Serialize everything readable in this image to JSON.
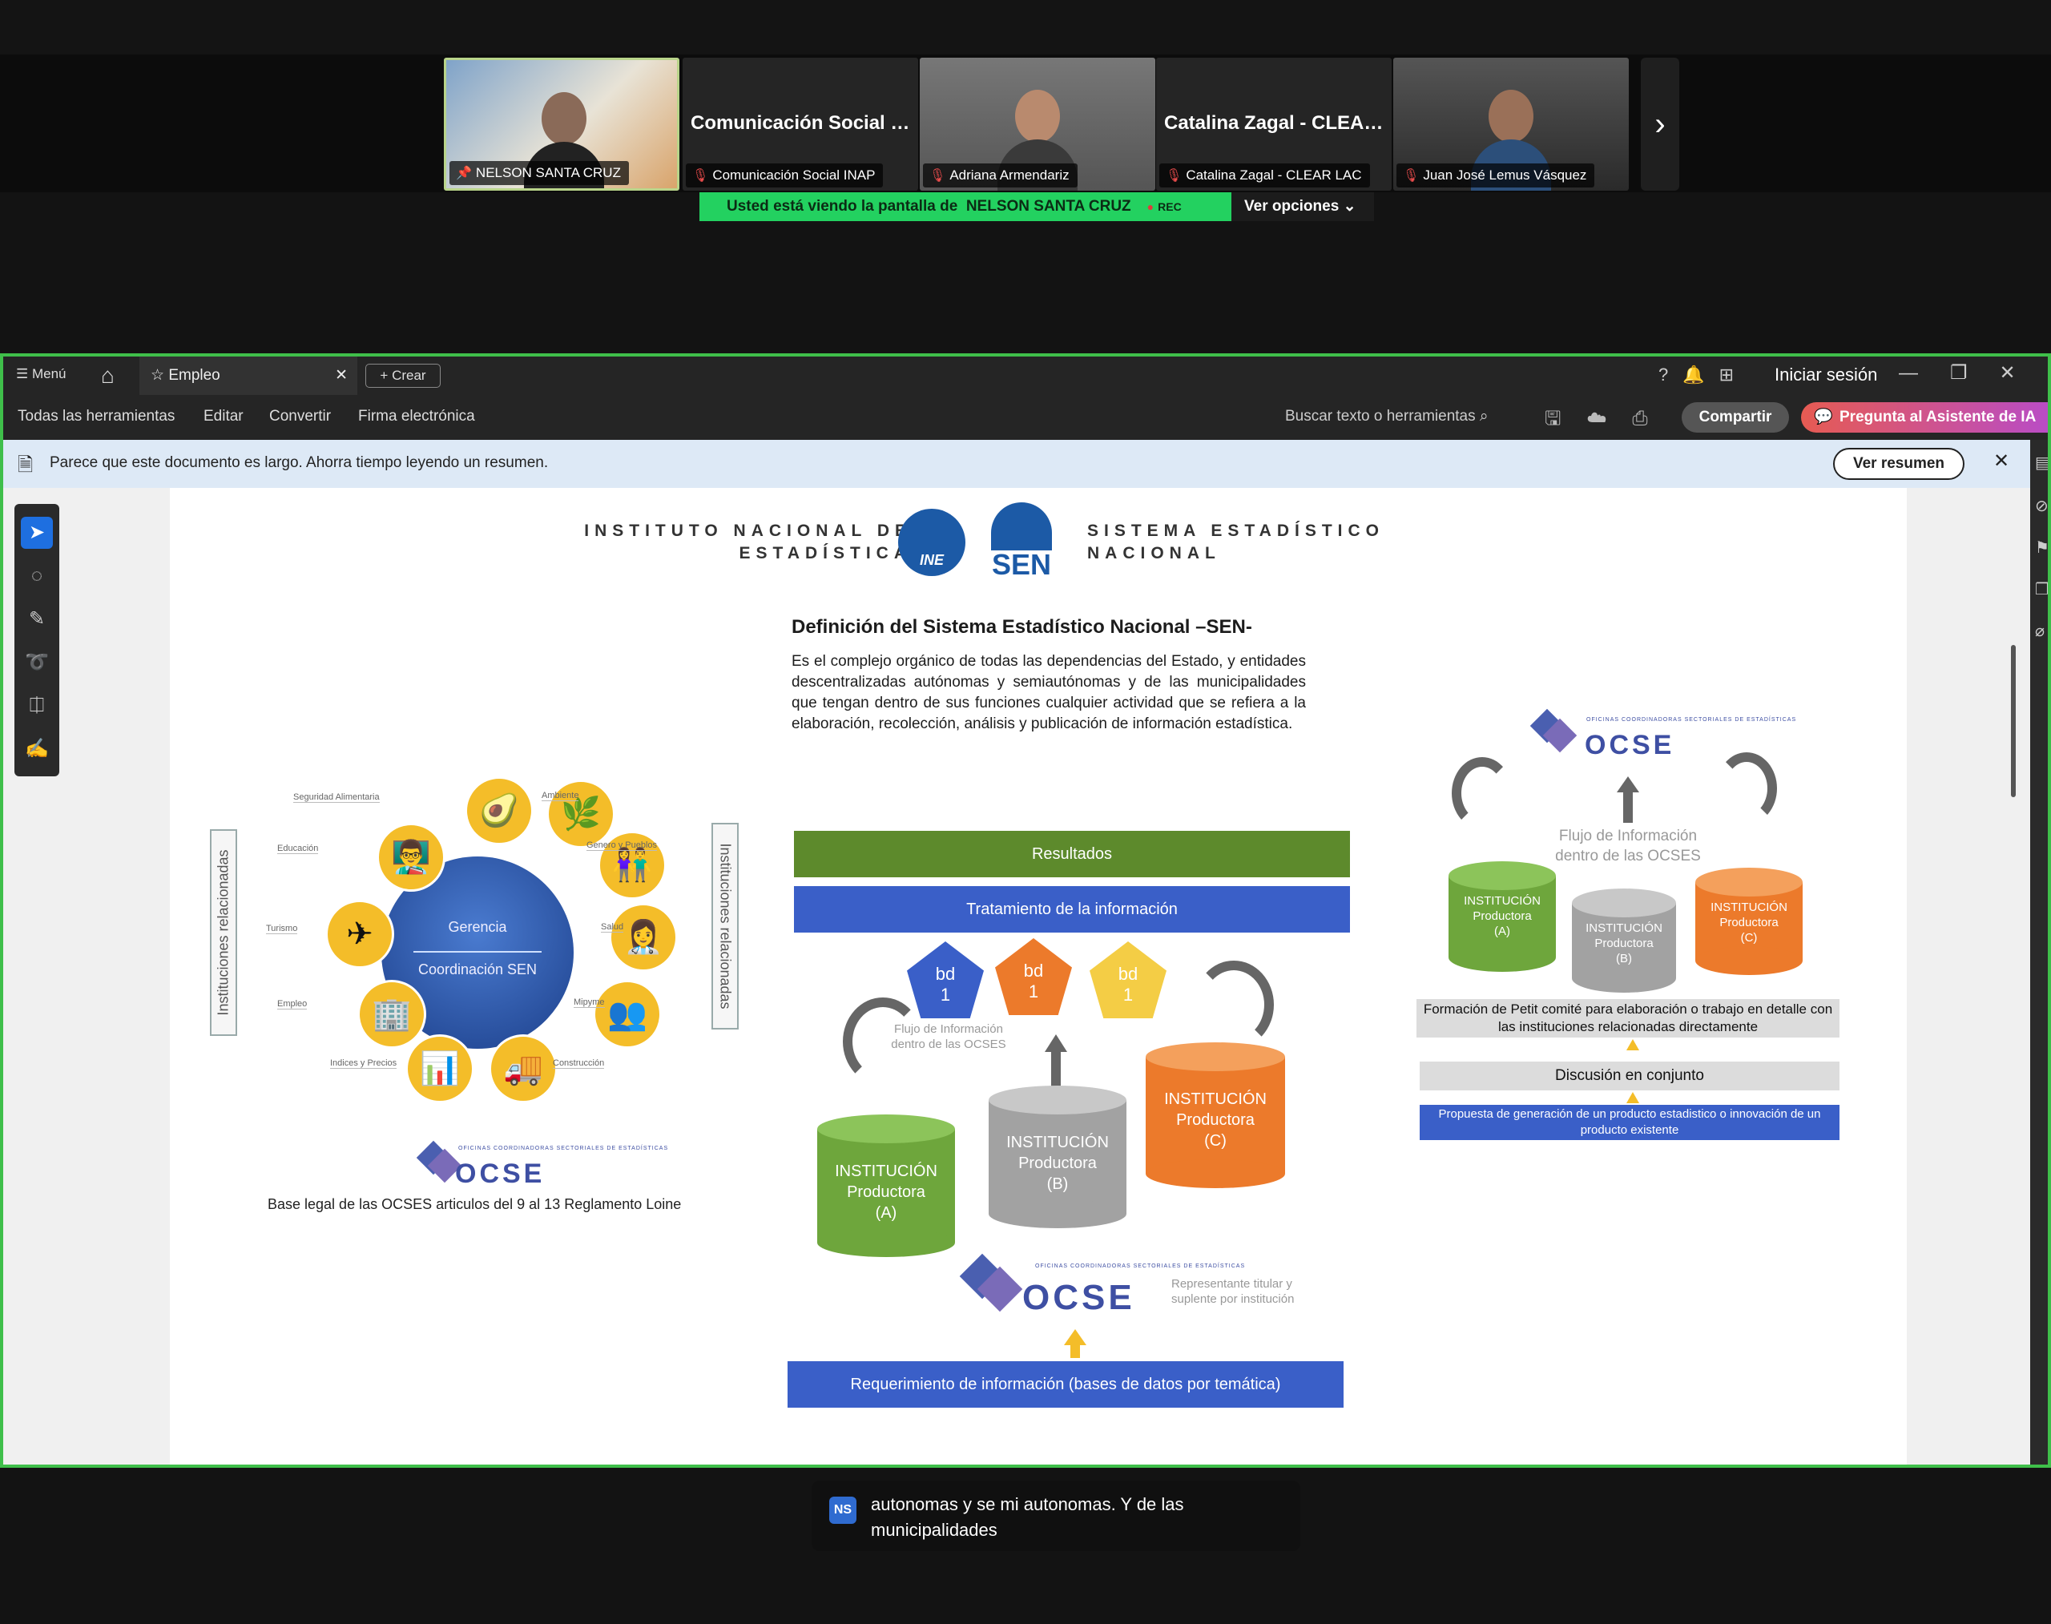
{
  "meeting": {
    "participants": [
      {
        "name": "NELSON SANTA CRUZ",
        "display": "",
        "pinned": true
      },
      {
        "name": "Comunicación Social INAP",
        "display": "Comunicación Social IN...",
        "pinned": false
      },
      {
        "name": "Adriana Armendariz",
        "display": "",
        "pinned": false
      },
      {
        "name": "Catalina Zagal - CLEAR LAC",
        "display": "Catalina Zagal - CLEAR...",
        "pinned": false
      },
      {
        "name": "Juan José Lemus Vásquez",
        "display": "",
        "pinned": false
      }
    ],
    "viewing_prefix": "Usted está viendo la pantalla de",
    "viewing_name": "NELSON SANTA CRUZ",
    "rec_label": "REC",
    "options_label": "Ver opciones",
    "caption_initials": "NS",
    "caption_text": "autonomas y se mi autonomas. Y de las municipalidades",
    "colors": {
      "viewing_green": "#23d160",
      "share_border": "#3fbf4a"
    }
  },
  "viewer": {
    "menu_label": "Menú",
    "tab_label": "Empleo",
    "create_label": "Crear",
    "signin_label": "Iniciar sesión",
    "toolbar": [
      "Todas las herramientas",
      "Editar",
      "Convertir",
      "Firma electrónica"
    ],
    "search_label": "Buscar texto o herramientas",
    "share_label": "Compartir",
    "ai_label": "Pregunta al Asistente de IA",
    "notice_text": "Parece que este documento es largo. Ahorra tiempo leyendo un resumen.",
    "summary_button": "Ver resumen",
    "tools": [
      "select-icon",
      "comment-icon",
      "pen-icon",
      "lasso-icon",
      "text-select-icon",
      "sign-icon"
    ]
  },
  "slide": {
    "header_left": [
      "INSTITUTO NACIONAL DE",
      "ESTADÍSTICA"
    ],
    "header_right": [
      "SISTEMA ESTADÍSTICO",
      "NACIONAL"
    ],
    "ine_logo_text": "INE",
    "sen_logo_text": "SEN",
    "title": "Definición del Sistema Estadístico Nacional –SEN-",
    "body": "Es el complejo orgánico de todas las dependencias del Estado, y entidades descentralizadas autónomas y semiautónomas y de las municipalidades que tengan dentro de sus funciones cualquier actividad que se refiera a la elaboración, recolección, análisis y publicación de información estadística.",
    "wheel": {
      "core_top": "Gerencia",
      "core_bottom": "Coordinación SEN",
      "labels": [
        "Seguridad Alimentaria",
        "Ambiente",
        "Educación",
        "Genero y Pueblos",
        "Turismo",
        "Salud",
        "Empleo",
        "Mipyme",
        "Indices y Precios",
        "Construcción"
      ],
      "side_label": "Instituciones relacionadas"
    },
    "ocse_word": "OCSE",
    "ocse_tiny": "OFICINAS COORDINADORAS SECTORIALES DE ESTADÍSTICAS",
    "base_legal": "Base legal de las OCSES  articulos del 9 al 13 Reglamento Loine",
    "center": {
      "resultados": "Resultados",
      "tratamiento": "Tratamiento de la información",
      "bd": [
        {
          "l1": "bd",
          "l2": "1"
        },
        {
          "l1": "bd",
          "l2": "1"
        },
        {
          "l1": "bd",
          "l2": "1"
        }
      ],
      "flujo": [
        "Flujo de Información",
        "dentro de las OCSES"
      ],
      "inst_a": [
        "INSTITUCIÓN",
        "Productora",
        "(A)"
      ],
      "inst_b": [
        "INSTITUCIÓN",
        "Productora",
        "(B)"
      ],
      "inst_c": [
        "INSTITUCIÓN",
        "Productora",
        "(C)"
      ],
      "representante": [
        "Representante titular y",
        "suplente por institución"
      ],
      "requerimiento": "Requerimiento de información (bases de datos por temática)"
    },
    "right": {
      "flujo": [
        "Flujo de Información",
        "dentro de las OCSES"
      ],
      "formacion": "Formación de Petit comité para elaboración o trabajo en detalle con las instituciones relacionadas directamente",
      "discusion": "Discusión en conjunto",
      "propuesta": "Propuesta de generación de un producto estadistico o innovación de un producto  existente"
    },
    "colors": {
      "green": "#5d8a2c",
      "blue": "#3a5fc8",
      "orange": "#ec7a2b",
      "yellow": "#f4bd29",
      "gray": "#a7a7a7",
      "navy": "#1c5aa6"
    }
  }
}
